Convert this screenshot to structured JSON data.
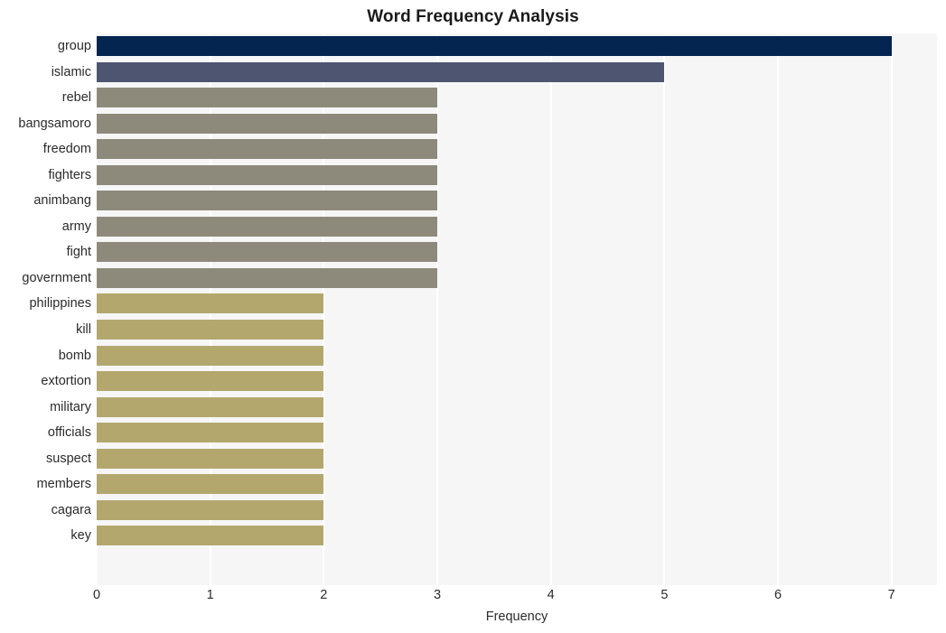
{
  "chart_data": {
    "type": "bar",
    "orientation": "horizontal",
    "title": "Word Frequency Analysis",
    "xlabel": "Frequency",
    "ylabel": "",
    "xlim": [
      0,
      7.4
    ],
    "xticks": [
      0,
      1,
      2,
      3,
      4,
      5,
      6,
      7
    ],
    "xtick_labels": [
      "0",
      "1",
      "2",
      "3",
      "4",
      "5",
      "6",
      "7"
    ],
    "grid": "vertical-white-on-light-gray",
    "legend": "none",
    "categories": [
      "group",
      "islamic",
      "rebel",
      "bangsamoro",
      "freedom",
      "fighters",
      "animbang",
      "army",
      "fight",
      "government",
      "philippines",
      "kill",
      "bomb",
      "extortion",
      "military",
      "officials",
      "suspect",
      "members",
      "cagara",
      "key"
    ],
    "values": [
      7,
      5,
      3,
      3,
      3,
      3,
      3,
      3,
      3,
      3,
      2,
      2,
      2,
      2,
      2,
      2,
      2,
      2,
      2,
      2
    ],
    "bar_colors": [
      "#04254f",
      "#4e5571",
      "#8e8a7b",
      "#8e8a7b",
      "#8e8a7b",
      "#8e8a7b",
      "#8e8a7b",
      "#8e8a7b",
      "#8e8a7b",
      "#8e8a7b",
      "#b3a76e",
      "#b3a76e",
      "#b3a76e",
      "#b3a76e",
      "#b3a76e",
      "#b3a76e",
      "#b3a76e",
      "#b3a76e",
      "#b3a76e",
      "#b3a76e"
    ],
    "plot_background": "#f6f6f7",
    "gridline_color": "#ffffff",
    "page_background": "#ffffff"
  }
}
